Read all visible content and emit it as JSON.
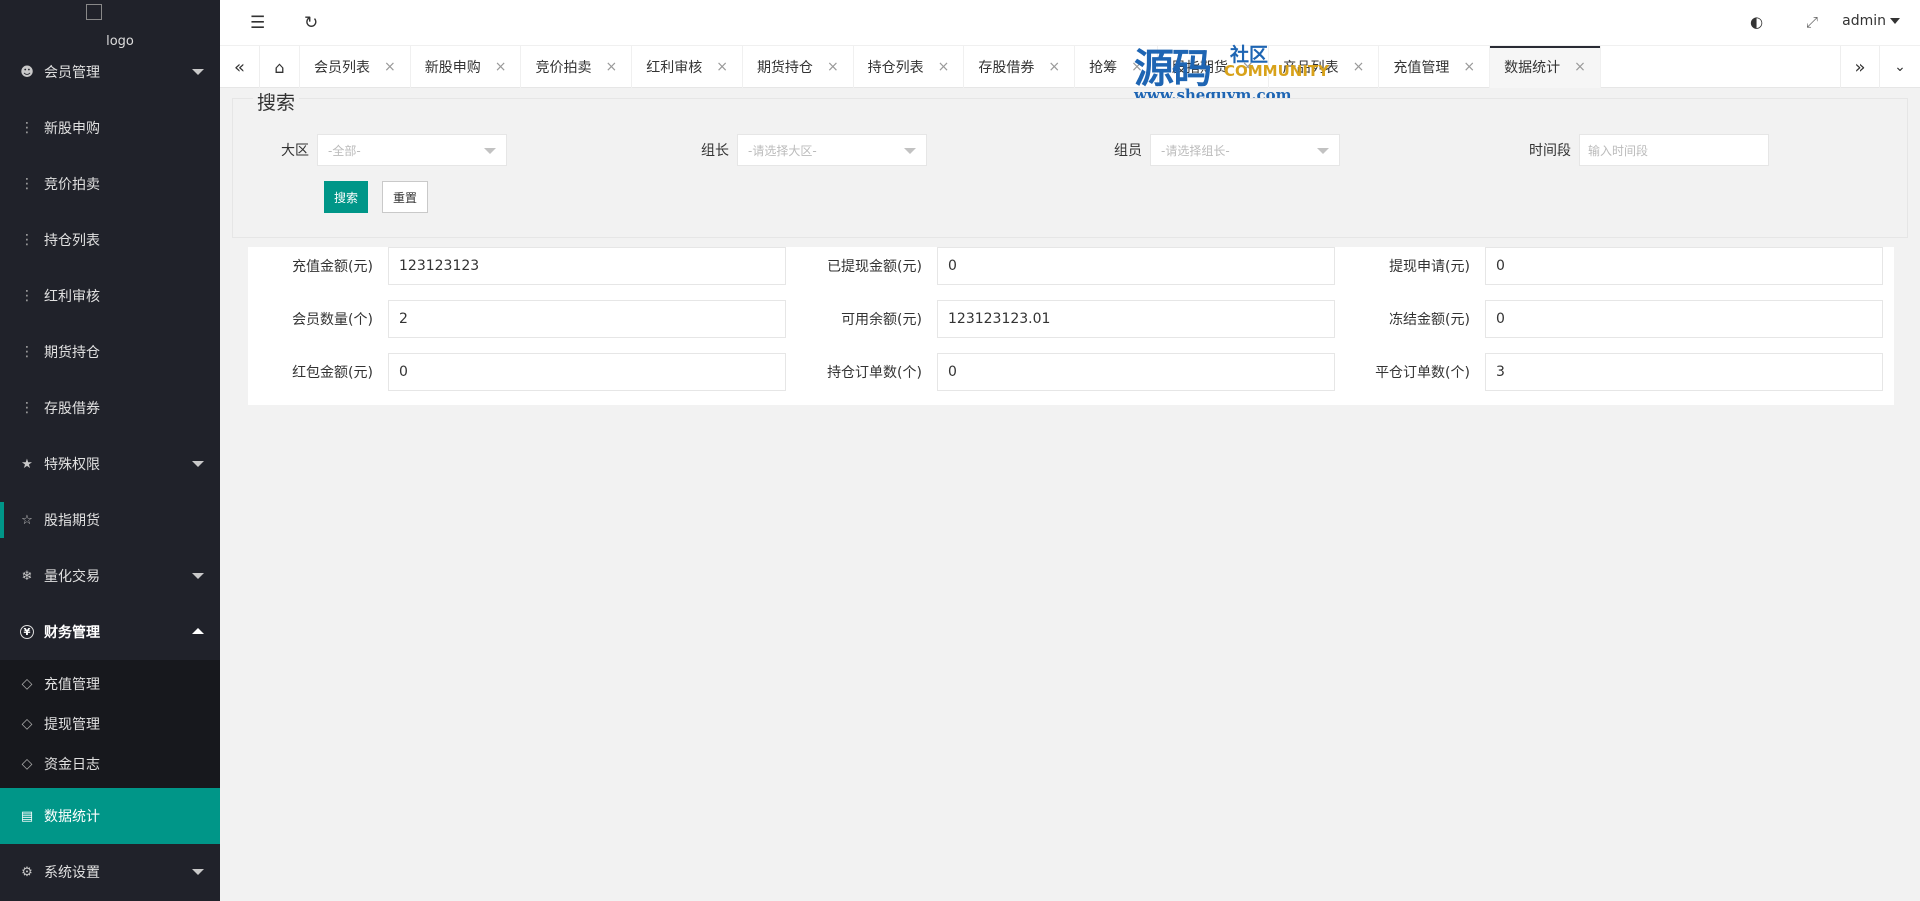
{
  "logo": {
    "alt": "logo"
  },
  "sidebar": {
    "items": [
      {
        "label": "会员管理",
        "icon": "user-icon"
      },
      {
        "label": "新股申购",
        "icon": "dots-icon"
      },
      {
        "label": "竞价拍卖",
        "icon": "dots-icon"
      },
      {
        "label": "持仓列表",
        "icon": "dots-icon"
      },
      {
        "label": "红利审核",
        "icon": "dots-icon"
      },
      {
        "label": "期货持仓",
        "icon": "dots-icon"
      },
      {
        "label": "存股借券",
        "icon": "dots-icon"
      },
      {
        "label": "特殊权限",
        "icon": "star-icon"
      },
      {
        "label": "股指期货",
        "icon": "star-outline-icon"
      },
      {
        "label": "量化交易",
        "icon": "snowflake-icon"
      },
      {
        "label": "财务管理",
        "icon": "yen-icon"
      },
      {
        "label": "充值管理",
        "icon": "diamond-icon"
      },
      {
        "label": "提现管理",
        "icon": "diamond-icon"
      },
      {
        "label": "资金日志",
        "icon": "diamond-icon"
      },
      {
        "label": "数据统计",
        "icon": "calendar-icon"
      },
      {
        "label": "系统设置",
        "icon": "gear-icon"
      }
    ]
  },
  "header": {
    "user": "admin"
  },
  "tabs": [
    {
      "label": "会员列表"
    },
    {
      "label": "新股申购"
    },
    {
      "label": "竞价拍卖"
    },
    {
      "label": "红利审核"
    },
    {
      "label": "期货持仓"
    },
    {
      "label": "持仓列表"
    },
    {
      "label": "存股借券"
    },
    {
      "label": "抢筹"
    },
    {
      "label": "股指期货"
    },
    {
      "label": "产品列表"
    },
    {
      "label": "充值管理"
    },
    {
      "label": "数据统计"
    }
  ],
  "watermark": {
    "big": "源码",
    "small": "社区",
    "community": "COMMUNITY",
    "url": "www.shequym.com"
  },
  "search": {
    "legend": "搜索",
    "region_label": "大区",
    "region_value": "-全部-",
    "leader_label": "组长",
    "leader_value": "-请选择大区-",
    "member_label": "组员",
    "member_value": "-请选择组长-",
    "time_label": "时间段",
    "time_placeholder": "输入时间段",
    "search_button": "搜索",
    "reset_button": "重置"
  },
  "stats": [
    [
      {
        "label": "充值金额(元)",
        "value": "123123123"
      },
      {
        "label": "已提现金额(元)",
        "value": "0"
      },
      {
        "label": "提现申请(元)",
        "value": "0"
      }
    ],
    [
      {
        "label": "会员数量(个)",
        "value": "2"
      },
      {
        "label": "可用余额(元)",
        "value": "123123123.01"
      },
      {
        "label": "冻结金额(元)",
        "value": "0"
      }
    ],
    [
      {
        "label": "红包金额(元)",
        "value": "0"
      },
      {
        "label": "持仓订单数(个)",
        "value": "0"
      },
      {
        "label": "平仓订单数(个)",
        "value": "3"
      }
    ]
  ],
  "colors": {
    "accent": "#009688",
    "sidebar_bg": "#20222a",
    "watermark_blue": "#1e65b3"
  }
}
